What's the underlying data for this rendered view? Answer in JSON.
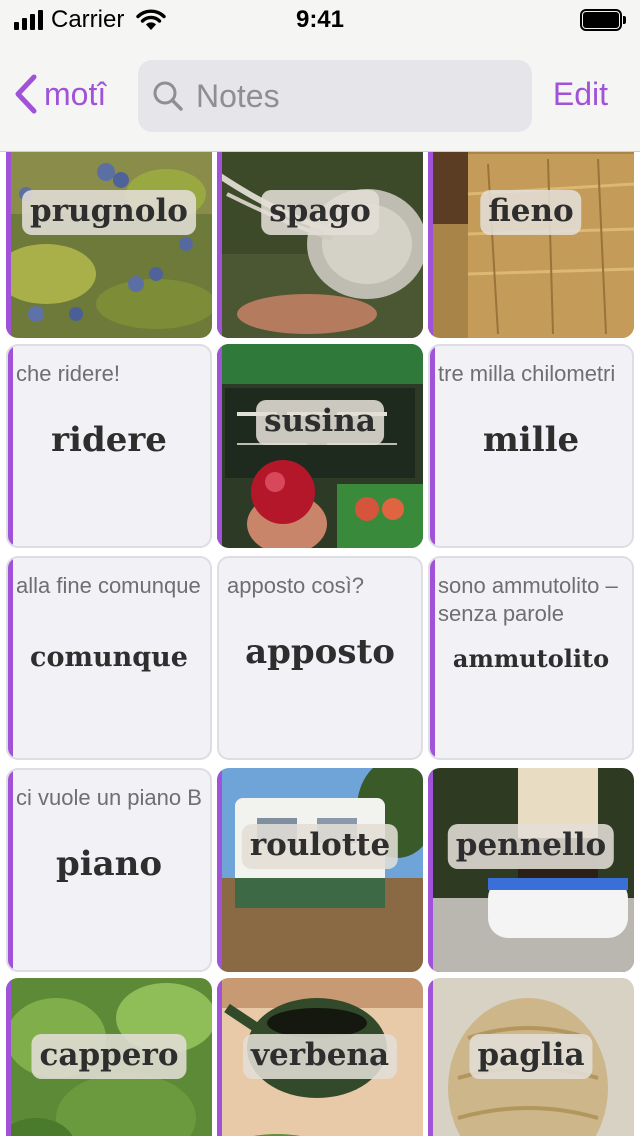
{
  "status_bar": {
    "carrier": "Carrier",
    "time": "9:41"
  },
  "nav": {
    "back_label": "motî",
    "search_placeholder": "Notes",
    "edit_label": "Edit"
  },
  "cards": [
    {
      "word": "prugnolo"
    },
    {
      "word": "spago"
    },
    {
      "word": "fieno"
    },
    {
      "word": "ridere",
      "note": "che ridere!"
    },
    {
      "word": "susina"
    },
    {
      "word": "mille",
      "note": "tre milla chilometri"
    },
    {
      "word": "comunque",
      "note": "alla fine comunque"
    },
    {
      "word": "apposto",
      "note": "apposto così?"
    },
    {
      "word": "ammutolito",
      "note": "sono ammutolito – senza parole"
    },
    {
      "word": "piano",
      "note": "ci vuole un piano B"
    },
    {
      "word": "roulotte"
    },
    {
      "word": "pennello"
    },
    {
      "word": "cappero"
    },
    {
      "word": "verbena"
    },
    {
      "word": "paglia"
    }
  ],
  "colors": {
    "accent": "#a052d8",
    "card_bg": "#f2f1f6"
  }
}
